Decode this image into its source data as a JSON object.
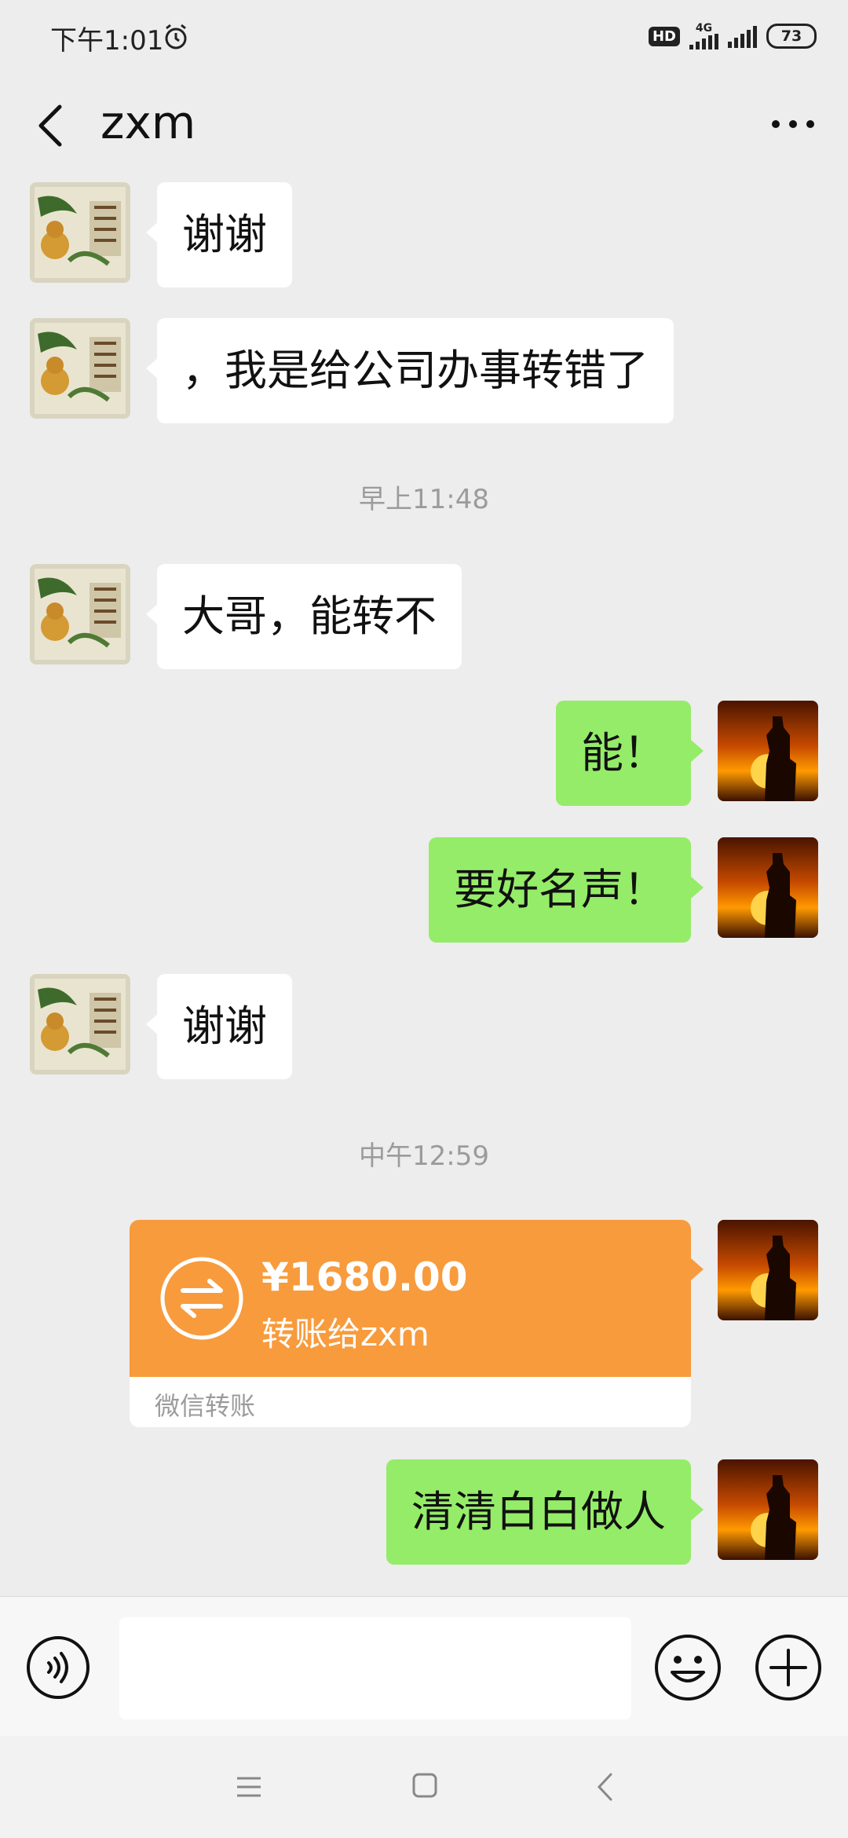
{
  "status_bar": {
    "time": "下午1:01",
    "network_badge": "HD",
    "network_type": "4G",
    "battery": "73"
  },
  "header": {
    "title": "zxm",
    "back_icon": "chevron-left-icon",
    "more_icon": "more-dots-icon"
  },
  "messages": [
    {
      "side": "in",
      "text": "谢谢"
    },
    {
      "side": "in",
      "text": "，我是给公司办事转错了"
    },
    {
      "type": "time",
      "text": "早上11:48"
    },
    {
      "side": "in",
      "text": "大哥，能转不"
    },
    {
      "side": "out",
      "text": "能！"
    },
    {
      "side": "out",
      "text": "要好名声！"
    },
    {
      "side": "in",
      "text": "谢谢"
    },
    {
      "type": "time",
      "text": "中午12:59"
    },
    {
      "type": "transfer",
      "amount": "¥1680.00",
      "description": "转账给zxm",
      "footer": "微信转账"
    },
    {
      "side": "out",
      "text": "清清白白做人"
    }
  ],
  "input_bar": {
    "voice_icon": "voice-icon",
    "emoji_icon": "emoji-icon",
    "plus_icon": "plus-icon",
    "placeholder": ""
  },
  "nav_bar": {
    "menu_icon": "menu-icon",
    "home_icon": "home-square-icon",
    "back_icon": "back-icon"
  },
  "colors": {
    "background": "#ededed",
    "incoming_bubble": "#ffffff",
    "outgoing_bubble": "#95ec69",
    "transfer_card": "#f89b3c",
    "timestamp_text": "#9b9b9b"
  }
}
